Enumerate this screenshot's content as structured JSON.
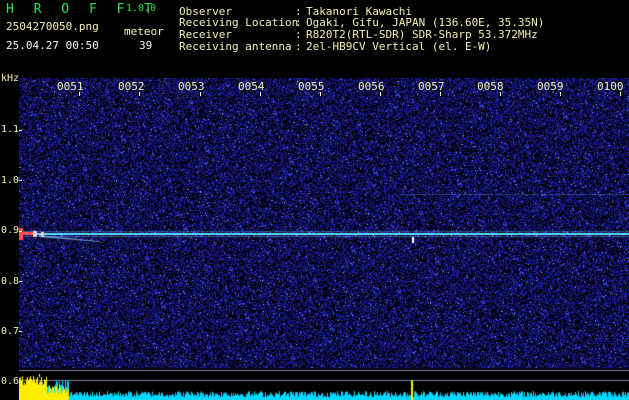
{
  "header": {
    "app_title": "H R O F F T",
    "app_version": "1.0.0",
    "filename": "2504270050.png",
    "meteor_label": "meteor",
    "datetime": "25.04.27 00:50",
    "meteor_count": "39"
  },
  "info": [
    {
      "key": "Observer",
      "value": "Takanori Kawachi"
    },
    {
      "key": "Receiving Location",
      "value": "Ogaki, Gifu, JAPAN (136.60E, 35.35N)"
    },
    {
      "key": "Receiver",
      "value": "R820T2(RTL-SDR) SDR-Sharp 53.372MHz"
    },
    {
      "key": "Receiving antenna",
      "value": "2el-HB9CV Vertical (el. E-W)"
    }
  ],
  "axis": {
    "y_unit": "kHz",
    "y_ticks": [
      "1.1",
      "1.0",
      "0.9",
      "0.8",
      "0.7",
      "0.6"
    ],
    "x_ticks": [
      "0051",
      "0052",
      "0053",
      "0054",
      "0055",
      "0056",
      "0057",
      "0058",
      "0059",
      "0100"
    ]
  },
  "colors": {
    "background": "#000000",
    "noise": "#1a1a8c",
    "carrier": "#5fe0ff",
    "meteor": "#ff5050",
    "activity_bars": "#00d8ff",
    "activity_peaks": "#ffee00"
  }
}
